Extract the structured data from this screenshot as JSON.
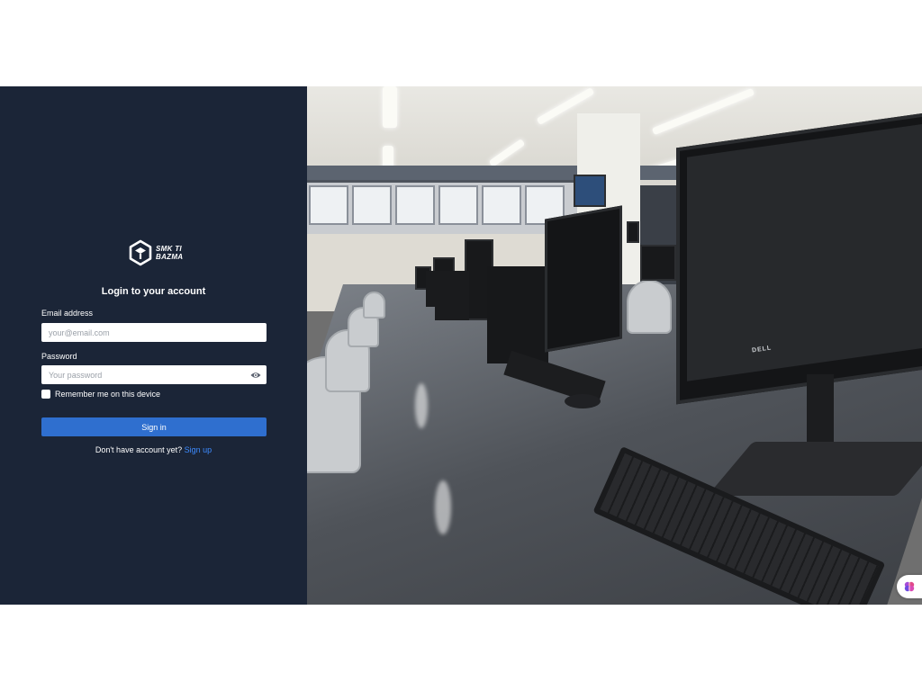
{
  "brand": {
    "line1": "SMK TI",
    "line2": "BAZMA"
  },
  "form": {
    "title": "Login to your account",
    "email_label": "Email address",
    "email_placeholder": "your@email.com",
    "email_value": "",
    "password_label": "Password",
    "password_placeholder": "Your password",
    "password_value": "",
    "remember_label": "Remember me on this device",
    "remember_checked": false,
    "signin_label": "Sign in",
    "signup_prompt": "Don't have account yet?",
    "signup_link": "Sign up"
  },
  "icons": {
    "logo": "hexagon-cube-logo-icon",
    "password_toggle": "eye-icon",
    "floating": "brain-icon"
  },
  "colors": {
    "panel_bg": "#1b2537",
    "primary": "#2f6fcf",
    "link": "#3d8bff",
    "page_bg": "#ffffff"
  }
}
